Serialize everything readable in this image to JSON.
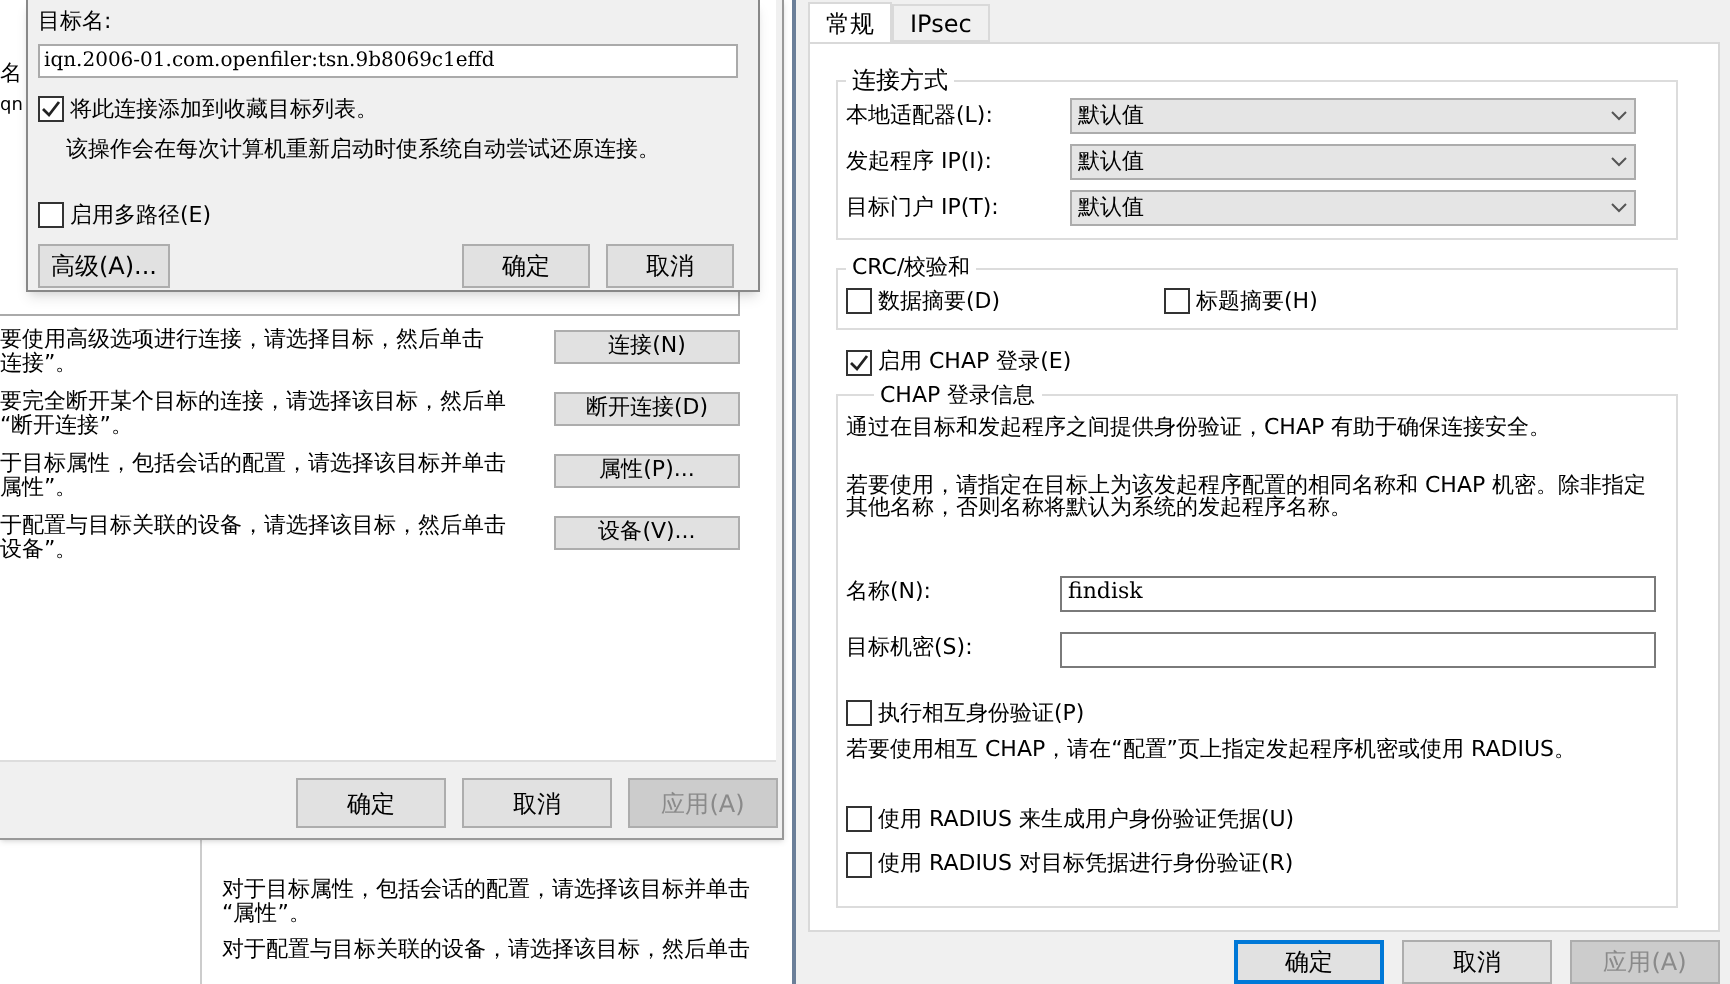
{
  "lower_window": {
    "lines": [
      "对于目标属性，包括会话的配置，请选择该目标并单击",
      "“属性”。",
      "对于配置与目标关联的设备，请选择该目标，然后单击"
    ]
  },
  "properties_window": {
    "list_header": "名",
    "list_cell": "qn",
    "actions": [
      {
        "description": [
          "要使用高级选项进行连接，请选择目标，然后单击",
          "连接”。"
        ],
        "button": "连接(N)"
      },
      {
        "description": [
          "要完全断开某个目标的连接，请选择该目标，然后单",
          "“断开连接”。"
        ],
        "button": "断开连接(D)"
      },
      {
        "description": [
          "于目标属性，包括会话的配置，请选择该目标并单击",
          "属性”。"
        ],
        "button": "属性(P)..."
      },
      {
        "description": [
          "于配置与目标关联的设备，请选择该目标，然后单击",
          "设备”。"
        ],
        "button": "设备(V)..."
      }
    ],
    "buttons": [
      {
        "label": "确定",
        "disabled": false
      },
      {
        "label": "取消",
        "disabled": false
      },
      {
        "label": "应用(A)",
        "disabled": true
      }
    ]
  },
  "connect_dialog": {
    "target_label": "目标名:",
    "target_value": "iqn.2006-01.com.openfiler:tsn.9b8069c1effd",
    "favorites": {
      "label": "将此连接添加到收藏目标列表。",
      "checked": true
    },
    "favorites_note": "该操作会在每次计算机重新启动时使系统自动尝试还原连接。",
    "multipath": {
      "label": "启用多路径(E)",
      "checked": false
    },
    "buttons": [
      "高级(A)...",
      "确定",
      "取消"
    ]
  },
  "advanced_dialog": {
    "tabs": [
      {
        "label": "常规",
        "selected": true
      },
      {
        "label": "IPsec",
        "selected": false
      }
    ],
    "connect_group": {
      "title": "连接方式",
      "rows": [
        {
          "label": "本地适配器(L):",
          "value": "默认值"
        },
        {
          "label": "发起程序 IP(I):",
          "value": "默认值"
        },
        {
          "label": "目标门户 IP(T):",
          "value": "默认值"
        }
      ]
    },
    "crc_group": {
      "title": "CRC/校验和",
      "options": [
        {
          "label": "数据摘要(D)",
          "checked": false
        },
        {
          "label": "标题摘要(H)",
          "checked": false
        }
      ]
    },
    "chap_enable": {
      "label": "启用 CHAP 登录(E)",
      "checked": true
    },
    "chap_group": {
      "title": "CHAP 登录信息",
      "intro": "通过在目标和发起程序之间提供身份验证，CHAP 有助于确保连接安全。",
      "usage": [
        "若要使用，请指定在目标上为该发起程序配置的相同名称和 CHAP 机密。除非指定",
        "其他名称，否则名称将默认为系统的发起程序名称。"
      ],
      "name_label": "名称(N):",
      "name_value": "findisk",
      "secret_label": "目标机密(S):",
      "mutual": {
        "label": "执行相互身份验证(P)",
        "checked": false
      },
      "mutual_note": "若要使用相互 CHAP，请在“配置”页上指定发起程序机密或使用 RADIUS。",
      "radius": [
        {
          "label": "使用 RADIUS 来生成用户身份验证凭据(U)",
          "checked": false
        },
        {
          "label": "使用 RADIUS 对目标凭据进行身份验证(R)",
          "checked": false
        }
      ]
    },
    "buttons": [
      {
        "label": "确定",
        "disabled": false,
        "focused": true
      },
      {
        "label": "取消",
        "disabled": false,
        "focused": false
      },
      {
        "label": "应用(A)",
        "disabled": true,
        "focused": false
      }
    ]
  }
}
